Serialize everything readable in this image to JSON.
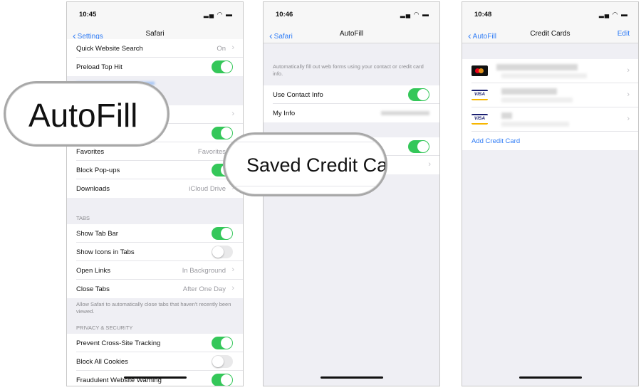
{
  "panels": [
    {
      "time": "10:45",
      "back": "Settings",
      "title": "Safari",
      "rows": {
        "quick_search": {
          "label": "Quick Website Search",
          "value": "On"
        },
        "preload": {
          "label": "Preload Top Hit",
          "on": true
        },
        "frequent": {
          "on": true
        },
        "favorites": {
          "label": "Favorites",
          "value": "Favorites"
        },
        "popups": {
          "label": "Block Pop-ups",
          "on": true
        },
        "downloads": {
          "label": "Downloads",
          "value": "iCloud Drive"
        },
        "show_tab_bar": {
          "label": "Show Tab Bar",
          "on": true
        },
        "show_icons": {
          "label": "Show Icons in Tabs",
          "on": false
        },
        "open_links": {
          "label": "Open Links",
          "value": "In Background"
        },
        "close_tabs": {
          "label": "Close Tabs",
          "value": "After One Day"
        },
        "cross_site": {
          "label": "Prevent Cross-Site Tracking",
          "on": true
        },
        "cookies": {
          "label": "Block All Cookies",
          "on": false
        },
        "fraud": {
          "label": "Fraudulent Website Warning",
          "on": true
        }
      },
      "tabs_header": "TABS",
      "tabs_footer": "Allow Safari to automatically close tabs that haven't recently been viewed.",
      "privacy_header": "PRIVACY & SECURITY"
    },
    {
      "time": "10:46",
      "back": "Safari",
      "title": "AutoFill",
      "description": "Automatically fill out web forms using your contact or credit card info.",
      "rows": {
        "contact": {
          "label": "Use Contact Info",
          "on": true
        },
        "my_info": {
          "label": "My Info"
        },
        "credit_cards": {
          "on": true
        }
      }
    },
    {
      "time": "10:48",
      "back": "AutoFill",
      "title": "Credit Cards",
      "edit": "Edit",
      "cards": [
        {
          "brand": "mastercard"
        },
        {
          "brand": "VISA"
        },
        {
          "brand": "VISA"
        }
      ],
      "add": "Add Credit Card"
    }
  ],
  "callouts": {
    "autofill": "AutoFill",
    "saved": "Saved Credit Ca"
  },
  "colors": {
    "accent": "#2f7cf6",
    "toggle_on": "#34c759"
  }
}
